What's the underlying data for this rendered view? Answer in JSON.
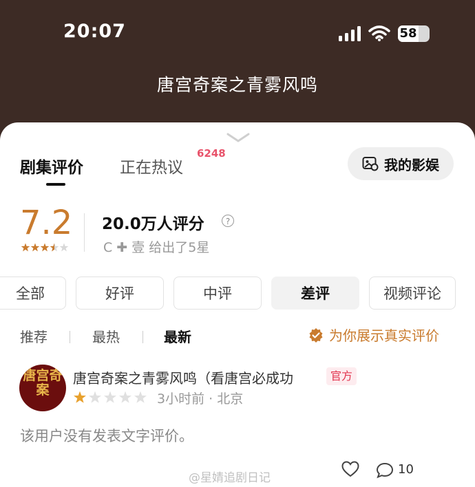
{
  "status_bar": {
    "time": "20:07",
    "battery": "58"
  },
  "header": {
    "title": "唐宫奇案之青雾风鸣"
  },
  "tabs": [
    {
      "label": "剧集评价",
      "active": true
    },
    {
      "label": "正在热议",
      "badge": "6248"
    }
  ],
  "my_button": {
    "label": "我的影娱"
  },
  "rating": {
    "score": "7.2",
    "star_rating": 3.5,
    "count": "20.0万人评分",
    "friend_note": "C ✚ 壹 给出了5星"
  },
  "filters": [
    {
      "label": "全部"
    },
    {
      "label": "好评"
    },
    {
      "label": "中评"
    },
    {
      "label": "差评",
      "active": true
    },
    {
      "label": "视频评论"
    }
  ],
  "sort": [
    {
      "label": "推荐"
    },
    {
      "label": "最热"
    },
    {
      "label": "最新",
      "active": true
    }
  ],
  "real_reviews": {
    "label": "为你展示真实评价"
  },
  "review": {
    "avatar_text": "唐宫奇案",
    "username": "唐宫奇案之青雾风鸣（看唐宫必成功",
    "badge": "官方",
    "stars": 1,
    "meta": "3小时前 · 北京",
    "content": "该用户没有发表文字评价。",
    "comment_count": "10"
  },
  "watermark": "@星婧追剧日记",
  "colors": {
    "accent": "#c97b2e",
    "header_bg": "#3d2b25",
    "badge_red": "#e8536b"
  }
}
